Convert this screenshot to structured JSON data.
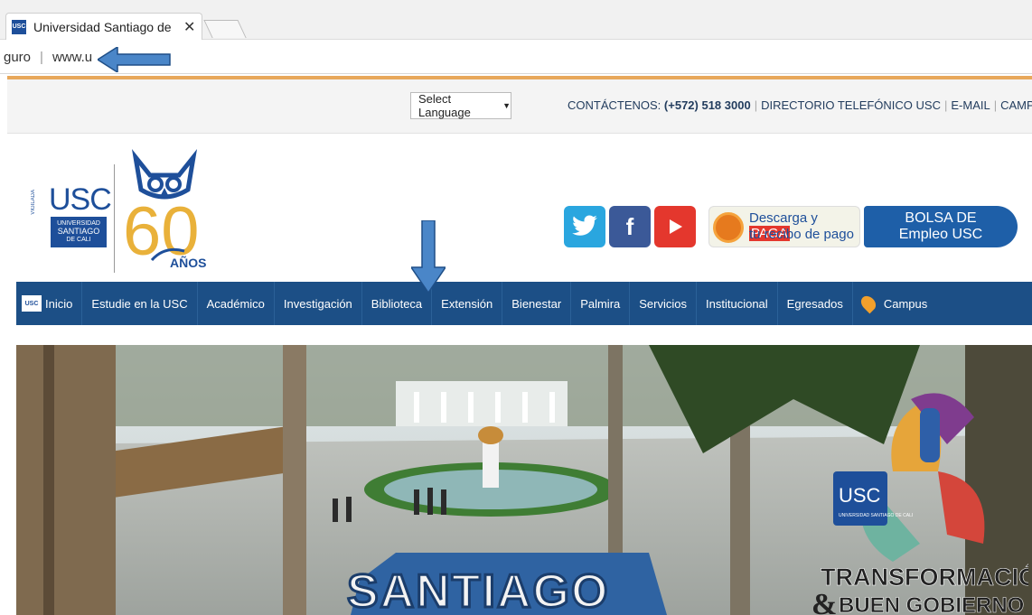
{
  "browser": {
    "tab_title": "Universidad Santiago de",
    "tab_close": "✕",
    "favicon": "USC",
    "url_prefix": "guro",
    "url": "www.u"
  },
  "topbar": {
    "language_select": "Select Language",
    "contact_label": "CONTÁCTENOS:",
    "phone": "(+572) 518 3000",
    "links": [
      "DIRECTORIO TELEFÓNICO USC",
      "E-MAIL",
      "CAMPUS"
    ]
  },
  "logo": {
    "vigilada": "VIGILADA",
    "acronym": "USC",
    "name_line1": "UNIVERSIDAD",
    "name_line2": "SANTIAGO",
    "name_line3": "DE CALI",
    "anniversary_number": "60",
    "anniversary_word": "AÑOS"
  },
  "banners": {
    "pay_line1_a": "Descarga y",
    "pay_line1_b": "PAGA",
    "pay_line2": "tu recibo de pago",
    "bolsa_line1": "BOLSA DE",
    "bolsa_line2": "Empleo USC"
  },
  "nav": {
    "home_icon": "USC",
    "items": [
      "Inicio",
      "Estudie en la USC",
      "Académico",
      "Investigación",
      "Biblioteca",
      "Extensión",
      "Bienestar",
      "Palmira",
      "Servicios",
      "Institucional",
      "Egresados",
      "Campus"
    ]
  },
  "hero": {
    "seal_acronym": "USC",
    "seal_name": "UNIVERSIDAD SANTIAGO DE CALI",
    "slogan_line1": "TRANSFORMACIÓN",
    "slogan_amp": "&",
    "slogan_line2": "BUEN GOBIERNO",
    "ground_logo": "SANTIAGO"
  },
  "colors": {
    "nav_bg": "#1c4f86",
    "brand_blue": "#1e4f9a",
    "orange": "#e8a85b",
    "annotation_arrow": "#4a86c8"
  }
}
